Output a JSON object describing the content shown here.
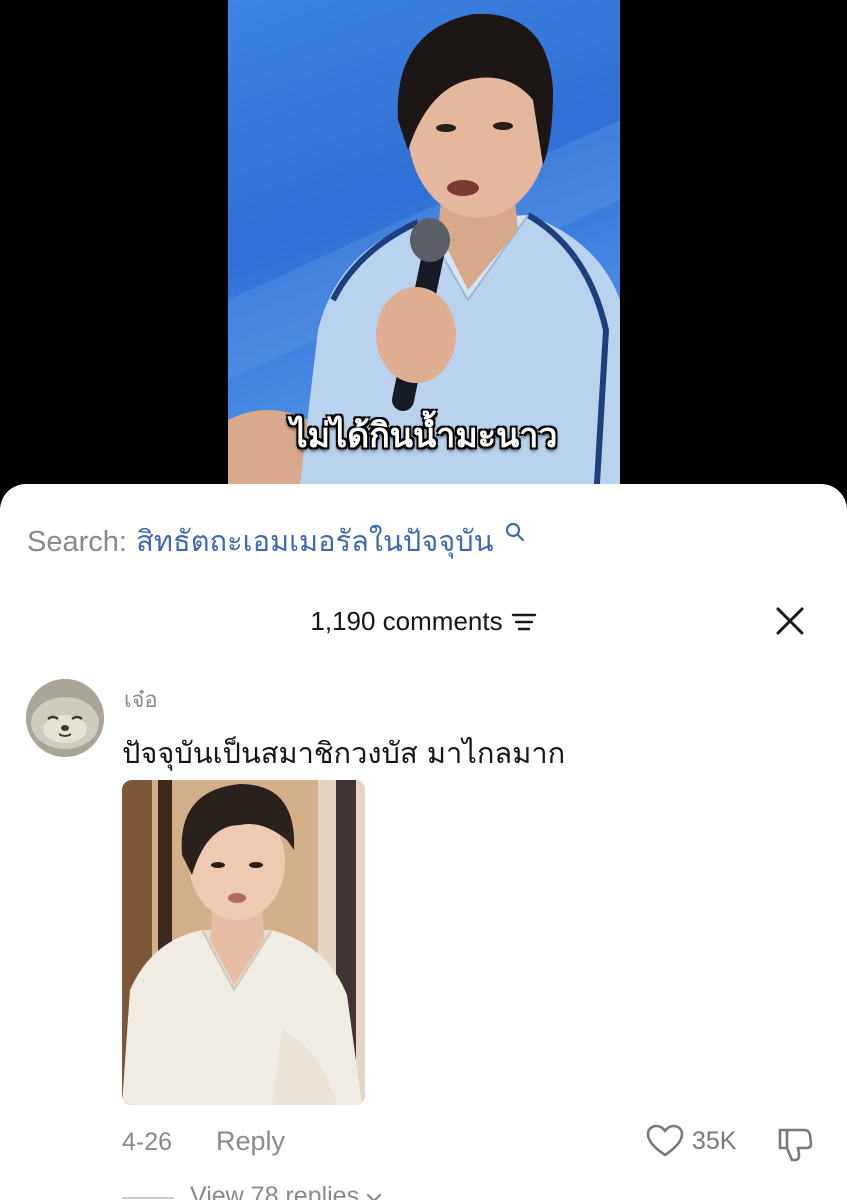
{
  "video": {
    "caption": "ไม่ได้กินน้ำมะนาว"
  },
  "search": {
    "prefix": "Search:",
    "term": "สิทธัตถะเอมเมอรัลในปัจจุบัน",
    "icon": "search-icon"
  },
  "comments_header": {
    "count_label": "1,190 comments",
    "filter_icon": "sort-icon",
    "close_icon": "close-icon"
  },
  "comment": {
    "username": "เจ๋อ",
    "text": "ปัจจุบันเป็นสมาชิกวงบัส มาไกลมาก",
    "date": "4-26",
    "reply_label": "Reply",
    "like_count": "35K",
    "like_icon": "heart-icon",
    "dislike_icon": "dislike-icon",
    "view_replies_label": "View 78 replies"
  },
  "colors": {
    "search_term": "#3d6bb3",
    "secondary_text": "#8a8a8a",
    "primary_text": "#161616",
    "sheet_bg": "#ffffff",
    "video_bg": "#2f6fd6"
  }
}
